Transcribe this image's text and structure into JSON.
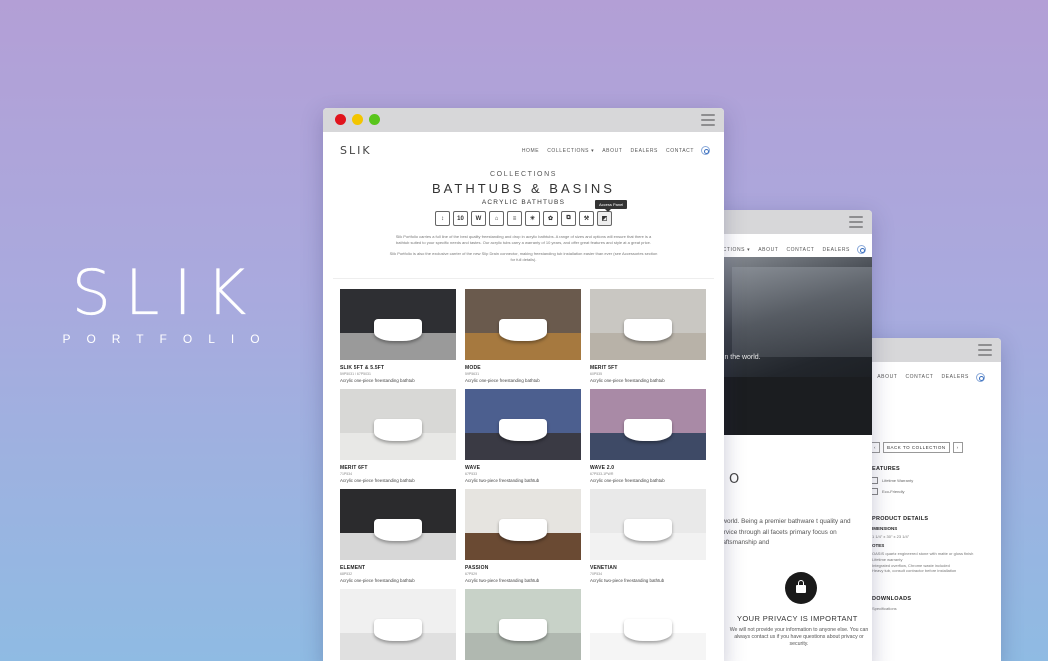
{
  "brand": {
    "logo": "SLIK",
    "tagline": "PORTFOLIO"
  },
  "window_main": {
    "traffic_colors": {
      "close": "#e1141d",
      "minimize": "#f3c500",
      "maximize": "#59c51c"
    },
    "logo": "SLIK",
    "nav": [
      "HOME",
      "COLLECTIONS ▾",
      "ABOUT",
      "DEALERS",
      "CONTACT"
    ],
    "kicker": "COLLECTIONS",
    "title": "BATHTUBS & BASINS",
    "subtitle": "ACRYLIC BATHTUBS",
    "tooltip": "Access Panel",
    "feature_icons": [
      {
        "name": "thermometer-icon",
        "glyph": "↕",
        "dark": false
      },
      {
        "name": "ten-year-warranty-icon",
        "glyph": "10",
        "dark": false
      },
      {
        "name": "w-icon",
        "glyph": "W",
        "dark": false
      },
      {
        "name": "faucet-icon",
        "glyph": "⌂",
        "dark": false
      },
      {
        "name": "overflow-icon",
        "glyph": "≡",
        "dark": false
      },
      {
        "name": "sun-icon",
        "glyph": "☀",
        "dark": false
      },
      {
        "name": "drain-icon",
        "glyph": "✿",
        "dark": false
      },
      {
        "name": "layers-icon",
        "glyph": "⧉",
        "dark": false
      },
      {
        "name": "tools-icon",
        "glyph": "⚒",
        "dark": false
      },
      {
        "name": "access-panel-icon",
        "glyph": "◩",
        "dark": true
      }
    ],
    "intro_1": "Slik Portfolio carries a full line of the best quality freestanding and drop in acrylic bathtubs. A range of sizes and options will ensure that there is a bathtub suited to your specific needs and tastes. Our acrylic tubs carry a warranty of 10 years, and offer great features and style at a great price.",
    "intro_2": "Slik Portfolio is also the exclusive carrier of the new Slip Drain connector, making freestanding tub installation easier than ever (see Accessories section for full details).",
    "products": [
      {
        "name": "SLIK 5FT & 5.5FT",
        "code": "59P5031 / 67P5031",
        "desc": "Acrylic one-piece freestanding bathtub",
        "bg": "#2e2f33",
        "floor": "#9a9a9a"
      },
      {
        "name": "MODE",
        "code": "59P5631",
        "desc": "Acrylic one-piece freestanding bathtub",
        "bg": "#6a5a4d",
        "floor": "#a6793f"
      },
      {
        "name": "MERIT 5FT",
        "code": "60P535",
        "desc": "Acrylic one-piece freestanding bathtub",
        "bg": "#c9c7c2",
        "floor": "#b8b2a8"
      },
      {
        "name": "MERIT 6FT",
        "code": "71P534",
        "desc": "Acrylic one-piece freestanding bathtub",
        "bg": "#d8d8d6",
        "floor": "#e8e8e6"
      },
      {
        "name": "WAVE",
        "code": "67P533",
        "desc": "Acrylic two-piece freestanding bathtub",
        "bg": "#4c5f8f",
        "floor": "#3a3a44"
      },
      {
        "name": "WAVE 2.0",
        "code": "67P533-1PWR",
        "desc": "Acrylic one-piece freestanding bathtub",
        "bg": "#a98aa6",
        "floor": "#3e4a66"
      },
      {
        "name": "ELEMENT",
        "code": "68P532",
        "desc": "Acrylic one-piece freestanding bathtub",
        "bg": "#2b2b2d",
        "floor": "#d7d7d7"
      },
      {
        "name": "PASSION",
        "code": "67P529",
        "desc": "Acrylic two-piece freestanding bathtub",
        "bg": "#e6e4e0",
        "floor": "#6a4a33"
      },
      {
        "name": "VENETIAN",
        "code": "70P534",
        "desc": "Acrylic two-piece freestanding bathtub",
        "bg": "#e9e9e9",
        "floor": "#f2f2f2"
      },
      {
        "name": "",
        "code": "",
        "desc": "",
        "bg": "#f0f0f0",
        "floor": "#e0e0e0"
      },
      {
        "name": "",
        "code": "",
        "desc": "",
        "bg": "#c8d2c8",
        "floor": "#b0b8b0"
      },
      {
        "name": "",
        "code": "",
        "desc": "",
        "bg": "#ffffff",
        "floor": "#f5f5f5"
      }
    ]
  },
  "window_middle": {
    "nav": [
      "CTIONS ▾",
      "ABOUT",
      "CONTACT",
      "DEALERS"
    ],
    "hero_text": "cts in the world.",
    "letter": "O",
    "copy": "e world. Being a premier bathware t quality and service through all facets primary focus on craftsmanship and",
    "privacy_title": "YOUR PRIVACY IS IMPORTANT",
    "privacy_text": "We will not provide your information to anyone else. You can always contact us if you have questions about privacy or security.",
    "privacy_left": "ne"
  },
  "window_back": {
    "nav": [
      "ABOUT",
      "CONTACT",
      "DEALERS"
    ],
    "back_button": "BACK TO COLLECTION",
    "prev_button": "‹",
    "next_button": "›",
    "features_heading": "EATURES",
    "feature_1": "Lifetime Warranty",
    "feature_2": "Eco-Friendly",
    "product_details_heading": "PRODUCT DETAILS",
    "dimensions_heading": "IMENSIONS",
    "dimensions_value": "1 1/4\" x 30\" x 23 1/4\"",
    "notes_heading": "OTES",
    "notes": [
      "OASIS quartz engineered stone with matte or gloss finish",
      "Lifetime warranty",
      "Integrated overflow, Chrome waste included",
      "Heavy tub, consult contractor before installation"
    ],
    "downloads_heading": "DOWNLOADS",
    "downloads_item": "Specifications"
  }
}
